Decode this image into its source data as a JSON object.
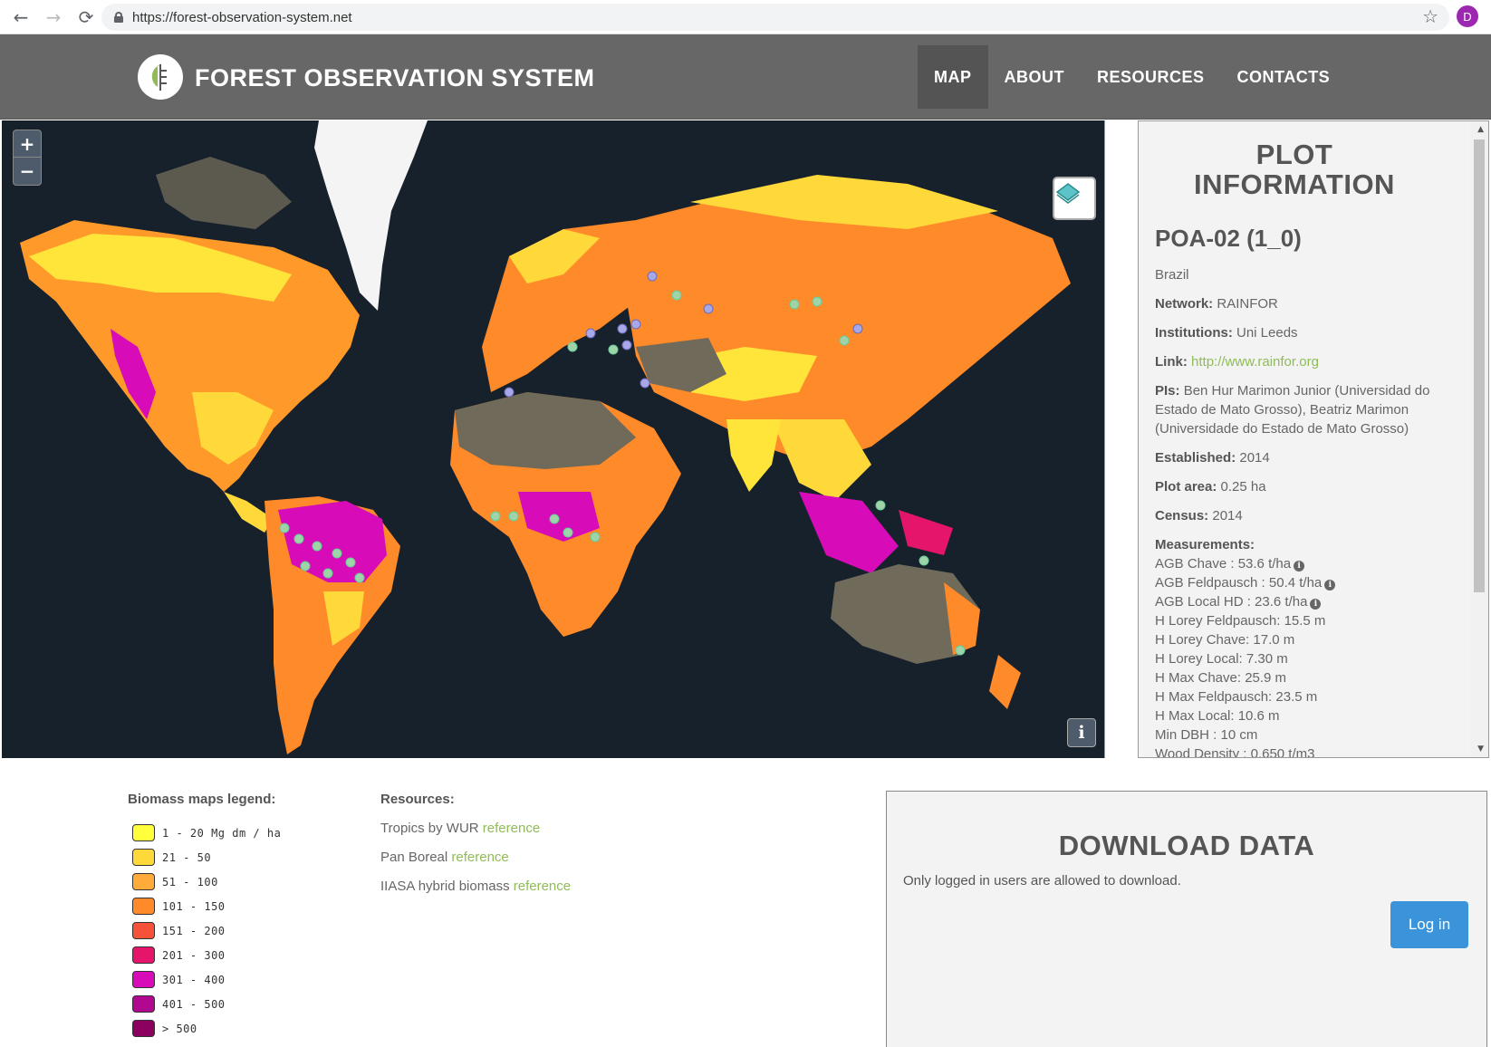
{
  "browser": {
    "url": "https://forest-observation-system.net",
    "profile_initial": "D",
    "back_icon": "←",
    "forward_icon": "→",
    "reload_icon": "⟳",
    "star_icon": "☆"
  },
  "header": {
    "title": "FOREST OBSERVATION SYSTEM",
    "menu": [
      {
        "label": "MAP",
        "active": true
      },
      {
        "label": "ABOUT",
        "active": false
      },
      {
        "label": "RESOURCES",
        "active": false
      },
      {
        "label": "CONTACTS",
        "active": false
      }
    ]
  },
  "map": {
    "zoom_in": "+",
    "zoom_out": "−",
    "info_label": "i",
    "ocean_color": "#17212b"
  },
  "plot": {
    "heading": "PLOT INFORMATION",
    "id": "POA-02 (1_0)",
    "country": "Brazil",
    "network_label": "Network:",
    "network": "RAINFOR",
    "institutions_label": "Institutions:",
    "institutions": "Uni Leeds",
    "link_label": "Link:",
    "link": "http://www.rainfor.org",
    "pis_label": "PIs:",
    "pis": "Ben Hur Marimon Junior (Universidad do Estado de Mato Grosso), Beatriz Marimon (Universidade do Estado de Mato Grosso)",
    "established_label": "Established:",
    "established": "2014",
    "area_label": "Plot area:",
    "area": "0.25 ha",
    "census_label": "Census:",
    "census": "2014",
    "measurements_label": "Measurements:",
    "measurements": [
      {
        "text": "AGB Chave : 53.6 t/ha",
        "info": true
      },
      {
        "text": "AGB Feldpausch : 50.4 t/ha",
        "info": true
      },
      {
        "text": "AGB Local HD : 23.6 t/ha",
        "info": true
      },
      {
        "text": "H Lorey Feldpausch: 15.5 m",
        "info": false
      },
      {
        "text": "H Lorey Chave: 17.0 m",
        "info": false
      },
      {
        "text": "H Lorey Local: 7.30 m",
        "info": false
      },
      {
        "text": "H Max Chave: 25.9 m",
        "info": false
      },
      {
        "text": "H Max Feldpausch: 23.5 m",
        "info": false
      },
      {
        "text": "H Max Local: 10.6 m",
        "info": false
      },
      {
        "text": "Min DBH : 10 cm",
        "info": false
      },
      {
        "text": "Wood Density : 0.650 t/m3",
        "info": false
      }
    ]
  },
  "legend": {
    "title": "Biomass maps legend:",
    "items": [
      {
        "label": "1 - 20 Mg dm / ha",
        "color": "#ffff3c"
      },
      {
        "label": "21 - 50",
        "color": "#ffd93a"
      },
      {
        "label": "51 - 100",
        "color": "#ffab3a"
      },
      {
        "label": "101 - 150",
        "color": "#ff8a2a"
      },
      {
        "label": "151 - 200",
        "color": "#f6523a"
      },
      {
        "label": "201 - 300",
        "color": "#e4156a"
      },
      {
        "label": "301 - 400",
        "color": "#d80bb8"
      },
      {
        "label": "401 - 500",
        "color": "#b0088e"
      },
      {
        "label": "> 500",
        "color": "#8c0060"
      }
    ]
  },
  "resources": {
    "title": "Resources:",
    "items": [
      {
        "text": "Tropics by WUR",
        "link": "reference"
      },
      {
        "text": "Pan Boreal",
        "link": "reference"
      },
      {
        "text": "IIASA hybrid biomass",
        "link": "reference"
      }
    ]
  },
  "download": {
    "title": "DOWNLOAD DATA",
    "note": "Only logged in users are allowed to download.",
    "login_label": "Log in"
  }
}
